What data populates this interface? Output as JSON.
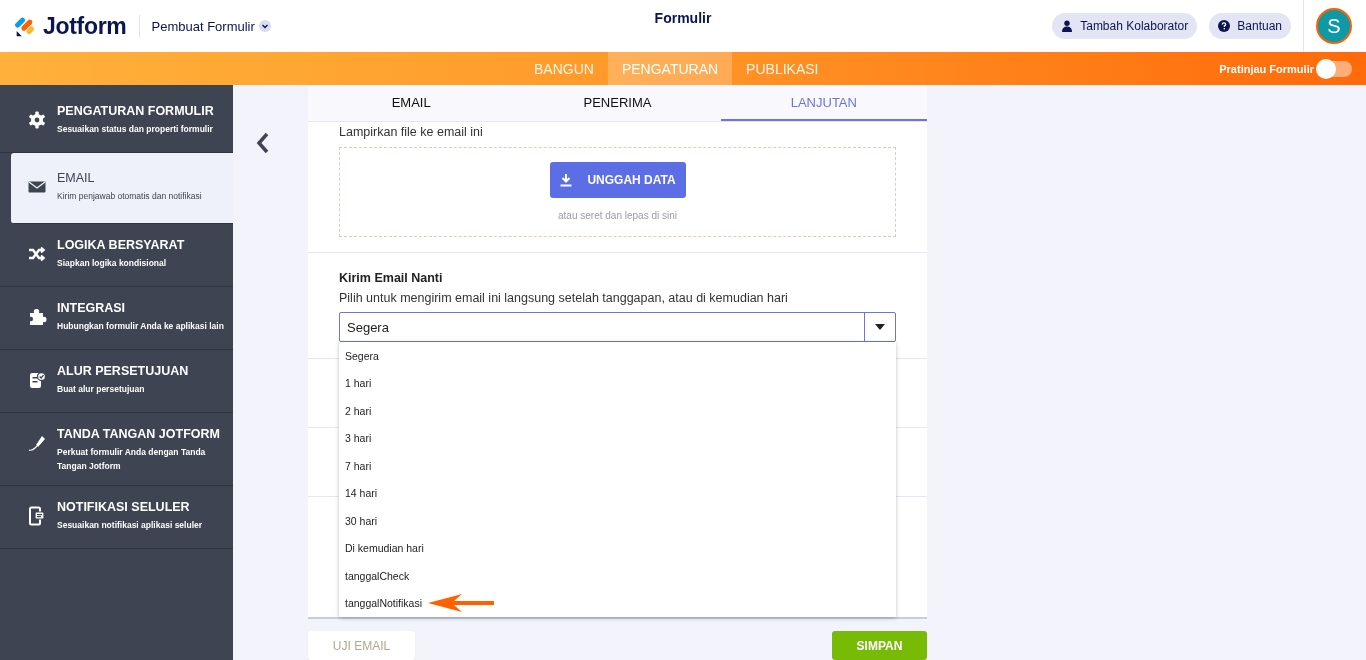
{
  "header": {
    "brand": "Jotform",
    "builder_menu": "Pembuat Formulir",
    "title": "Formulir",
    "collaborator_button": "Tambah Kolaborator",
    "help_button": "Bantuan",
    "avatar": "S"
  },
  "nav_tabs": [
    {
      "label": "BANGUN",
      "selected": false
    },
    {
      "label": "PENGATURAN",
      "selected": true
    },
    {
      "label": "PUBLIKASI",
      "selected": false
    }
  ],
  "preview": {
    "label": "Pratinjau Formulir",
    "on": false
  },
  "sidebar": {
    "items": [
      {
        "title": "PENGATURAN FORMULIR",
        "subtitle": "Sesuaikan status dan properti formulir",
        "kind": "gear",
        "selected": false
      },
      {
        "title": "EMAIL",
        "subtitle": "Kirim penjawab otomatis dan notifikasi",
        "kind": "envelope",
        "selected": true
      },
      {
        "title": "LOGIKA BERSYARAT",
        "subtitle": "Siapkan logika kondisional",
        "kind": "shuffle",
        "selected": false
      },
      {
        "title": "INTEGRASI",
        "subtitle": "Hubungkan formulir Anda ke aplikasi lain",
        "kind": "puzzle",
        "selected": false
      },
      {
        "title": "ALUR PERSETUJUAN",
        "subtitle": "Buat alur persetujuan",
        "kind": "approval",
        "selected": false
      },
      {
        "title": "TANDA TANGAN JOTFORM",
        "subtitle": "Perkuat formulir Anda dengan Tanda Tangan Jotform",
        "kind": "pen",
        "selected": false
      },
      {
        "title": "NOTIFIKASI SELULER",
        "subtitle": "Sesuaikan notifikasi aplikasi seluler",
        "kind": "phone",
        "selected": false
      }
    ]
  },
  "tabs": [
    {
      "label": "EMAIL",
      "selected": false
    },
    {
      "label": "PENERIMA",
      "selected": false
    },
    {
      "label": "LANJUTAN",
      "selected": true
    }
  ],
  "attach": {
    "label": "Lampirkan file ke email ini",
    "upload_button": "UNGGAH DATA",
    "hint": "atau seret dan lepas di sini"
  },
  "send_later": {
    "title": "Kirim Email Nanti",
    "description": "Pilih untuk mengirim email ini langsung setelah tanggapan, atau di kemudian hari",
    "value": "Segera",
    "expanded": true,
    "options": [
      {
        "label": "Segera",
        "pointed": false
      },
      {
        "label": "1 hari",
        "pointed": false
      },
      {
        "label": "2 hari",
        "pointed": false
      },
      {
        "label": "3 hari",
        "pointed": false
      },
      {
        "label": "7 hari",
        "pointed": false
      },
      {
        "label": "14 hari",
        "pointed": false
      },
      {
        "label": "30 hari",
        "pointed": false
      },
      {
        "label": "Di kemudian hari",
        "pointed": false
      },
      {
        "label": "tanggalCheck",
        "pointed": false
      },
      {
        "label": "tanggalNotifikasi",
        "pointed": true
      }
    ]
  },
  "footer": {
    "test_button": "UJI EMAIL",
    "save_button": "SIMPAN"
  }
}
